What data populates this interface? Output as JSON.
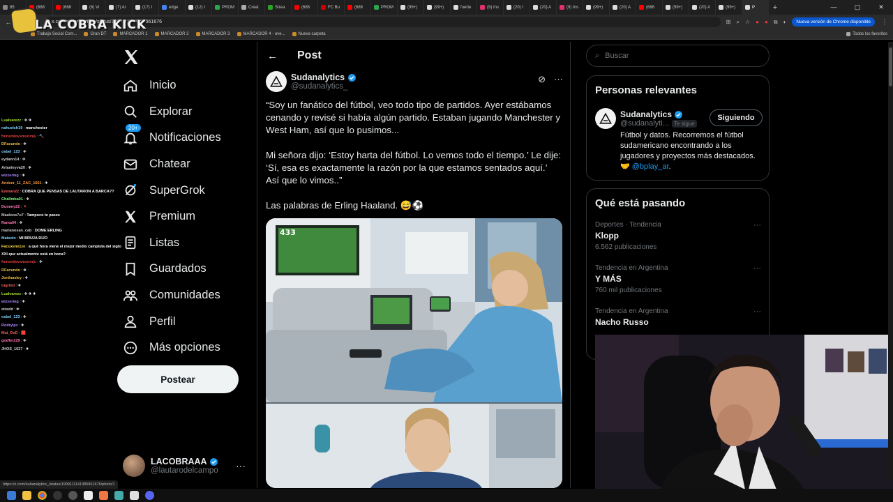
{
  "browser": {
    "tabs": [
      {
        "label": "85",
        "color": "#888"
      },
      {
        "label": "(688",
        "color": "#ff0000"
      },
      {
        "label": "(688",
        "color": "#ff0000"
      },
      {
        "label": "(6) Vi",
        "color": "#ddd"
      },
      {
        "label": "(7) Ar",
        "color": "#ddd"
      },
      {
        "label": "(17) I",
        "color": "#ddd"
      },
      {
        "label": "edge",
        "color": "#4285f4"
      },
      {
        "label": "(12) I",
        "color": "#ddd"
      },
      {
        "label": "PROM",
        "color": "#2ea44f"
      },
      {
        "label": "Creat",
        "color": "#aaa"
      },
      {
        "label": "Strea",
        "color": "#29a329"
      },
      {
        "label": "(688",
        "color": "#ff0000"
      },
      {
        "label": "FC Bu",
        "color": "#c00"
      },
      {
        "label": "(688",
        "color": "#ff0000"
      },
      {
        "label": "PROM",
        "color": "#2ea44f"
      },
      {
        "label": "(99+)",
        "color": "#ddd"
      },
      {
        "label": "(99+)",
        "color": "#ddd"
      },
      {
        "label": "fuerte",
        "color": "#ddd"
      },
      {
        "label": "(9) Ins",
        "color": "#e1306c"
      },
      {
        "label": "(20) I",
        "color": "#ddd"
      },
      {
        "label": "(20) A",
        "color": "#ddd"
      },
      {
        "label": "(9) Ins",
        "color": "#e1306c"
      },
      {
        "label": "(99+)",
        "color": "#ddd"
      },
      {
        "label": "(20) A",
        "color": "#ddd"
      },
      {
        "label": "(688",
        "color": "#ff0000"
      },
      {
        "label": "(99+)",
        "color": "#ddd"
      },
      {
        "label": "(20) A",
        "color": "#ddd"
      },
      {
        "label": "(99+)",
        "color": "#ddd"
      },
      {
        "label": "P",
        "color": "#ddd",
        "active": true
      }
    ],
    "url": "x.com/sudanalytics_/status/1999111141385961676",
    "update_label": "Nueva versión de Chrome disponible",
    "bookmarks": [
      "Trabajo Social Com...",
      "Gran DT",
      "MARCADOR 1",
      "MARCADOR 2",
      "MARCADOR 3",
      "MARCADOR 4 - ove...",
      "Nueva carpeta"
    ],
    "bookmarks_right": "Todos los favoritos",
    "status_url": "https://x.com/sudanalytics_/status/1999111141385961676/photo/1"
  },
  "overlay": {
    "title": "LA COBRA KICK"
  },
  "chat": [
    {
      "user": "Lualvarezz",
      "msg": "✈ ✈",
      "color": "#a6e22e"
    },
    {
      "user": "nahuelch19",
      "msg": "manchester",
      "color": "#7fd3ff"
    },
    {
      "user": "fnmsmlovsmsnmjs",
      "msg": "🔨",
      "color": "#e04040"
    },
    {
      "user": "DFacundo",
      "msg": "✈",
      "color": "#f0c040"
    },
    {
      "user": "osbel_123",
      "msg": "✈",
      "color": "#7fd3ff"
    },
    {
      "user": "eydann14",
      "msg": "✈",
      "color": "#cfcfcf"
    },
    {
      "user": "Arianleyva20",
      "msg": "✈",
      "color": "#cfcfcf"
    },
    {
      "user": "wizzering",
      "msg": "✈",
      "color": "#b088ff"
    },
    {
      "user": "Andeer_11_ZAC_1661",
      "msg": "✈",
      "color": "#ff9a3c"
    },
    {
      "user": "Ezexan22",
      "msg": "COBRA QUE PENSAS DE LAUTARON A BARCA??",
      "color": "#ff5e5e"
    },
    {
      "user": "Challmba01",
      "msg": "✈",
      "color": "#7fff7f"
    },
    {
      "user": "Dummy22",
      "msg": "🔻",
      "color": "#ff7ab6"
    },
    {
      "user": "Mauloos7u7",
      "msg": "Tampoco te pases",
      "color": "#cfcfcf"
    },
    {
      "user": "Rama04",
      "msg": "✈",
      "color": "#ff7ab6"
    },
    {
      "user": "marianosan_cab",
      "msg": "DOME ERLING",
      "color": "#cfcfcf"
    },
    {
      "user": "MateoIn",
      "msg": "MI BRUJA DIJO",
      "color": "#7fd3ff"
    },
    {
      "user": "Facuxene1ze",
      "msg": "a qué hora viene el mejor medio campista del siglo",
      "color": "#ffd84a"
    },
    {
      "user": "",
      "msg": "XXI que actualmente está en boca?",
      "color": "#ffd84a"
    },
    {
      "user": "fnmsmlovsmsnmjs",
      "msg": "✈",
      "color": "#e04040"
    },
    {
      "user": "DFacundo",
      "msg": "✈",
      "color": "#f0c040"
    },
    {
      "user": "Jordnasley",
      "msg": "✈",
      "color": "#f0c040"
    },
    {
      "user": "tugrind",
      "msg": "✈",
      "color": "#ff5e5e"
    },
    {
      "user": "Lualvarezz",
      "msg": "✈ ✈ ✈",
      "color": "#a6e22e"
    },
    {
      "user": "wizzering",
      "msg": "✈",
      "color": "#b088ff"
    },
    {
      "user": "etradd",
      "msg": "✈",
      "color": "#cfcfcf"
    },
    {
      "user": "osbel_123",
      "msg": "✈",
      "color": "#7fd3ff"
    },
    {
      "user": "Rodrylpz",
      "msg": "✈",
      "color": "#b088ff"
    },
    {
      "user": "Mat_DvD",
      "msg": "🟥",
      "color": "#ff5e5e"
    },
    {
      "user": "graffer229",
      "msg": "✈",
      "color": "#ff7ab6"
    },
    {
      "user": "JHOS_1627",
      "msg": "✈",
      "color": "#cfcfcf"
    }
  ],
  "sidebar": {
    "items": [
      {
        "label": "Inicio",
        "icon": "home-icon"
      },
      {
        "label": "Explorar",
        "icon": "search-icon"
      },
      {
        "label": "Notificaciones",
        "icon": "bell-icon",
        "badge": "20+"
      },
      {
        "label": "Chatear",
        "icon": "mail-icon"
      },
      {
        "label": "SuperGrok",
        "icon": "grok-icon"
      },
      {
        "label": "Premium",
        "icon": "x-premium-icon"
      },
      {
        "label": "Listas",
        "icon": "list-icon"
      },
      {
        "label": "Guardados",
        "icon": "bookmark-icon"
      },
      {
        "label": "Comunidades",
        "icon": "communities-icon"
      },
      {
        "label": "Perfil",
        "icon": "person-icon"
      },
      {
        "label": "Más opciones",
        "icon": "more-circle-icon"
      }
    ],
    "post_label": "Postear",
    "account": {
      "name": "LACOBRAAA",
      "handle": "@lautarodelcampo"
    }
  },
  "post": {
    "header_title": "Post",
    "author_name": "Sudanalytics",
    "author_handle": "@sudanalytics_",
    "paragraphs": [
      "“Soy un fanático del fútbol, veo todo tipo de partidos. Ayer estábamos cenando y revisé si había algún partido. Estaban jugando Manchester y West Ham, así que lo pusimos...",
      "Mi señora dijo: ‘Estoy harta del fútbol. Lo vemos todo el tiempo.’ Le dije: ‘Sí, esa es exactamente la razón por la que estamos sentados aquí.’ Así que lo vimos..”",
      "Las palabras de Erling Haaland. 😅⚽"
    ],
    "tv_label": "433"
  },
  "right": {
    "search_placeholder": "Buscar",
    "relevant_title": "Personas relevantes",
    "relevant": {
      "name": "Sudanalytics",
      "handle": "@sudanalyti...",
      "follows_you": "Te sigue",
      "button": "Siguiendo",
      "bio": "Fútbol y datos. Recorremos el fútbol sudamericano encontrando a los jugadores y proyectos más destacados. 🤝 ",
      "bio_link": "@bplay_ar",
      "bio_end": "."
    },
    "trends_title": "Qué está pasando",
    "trends": [
      {
        "category": "Deportes · Tendencia",
        "name": "Klopp",
        "count": "6.562 publicaciones"
      },
      {
        "category": "Tendencia en Argentina",
        "name": "Y MÁS",
        "count": "760 mil publicaciones"
      },
      {
        "category": "Tendencia en Argentina",
        "name": "Nacho Russo",
        "count": ""
      }
    ]
  },
  "colors": {
    "accent": "#1d9bf0",
    "background": "#000000",
    "text": "#e7e9ea",
    "muted": "#71767b"
  }
}
